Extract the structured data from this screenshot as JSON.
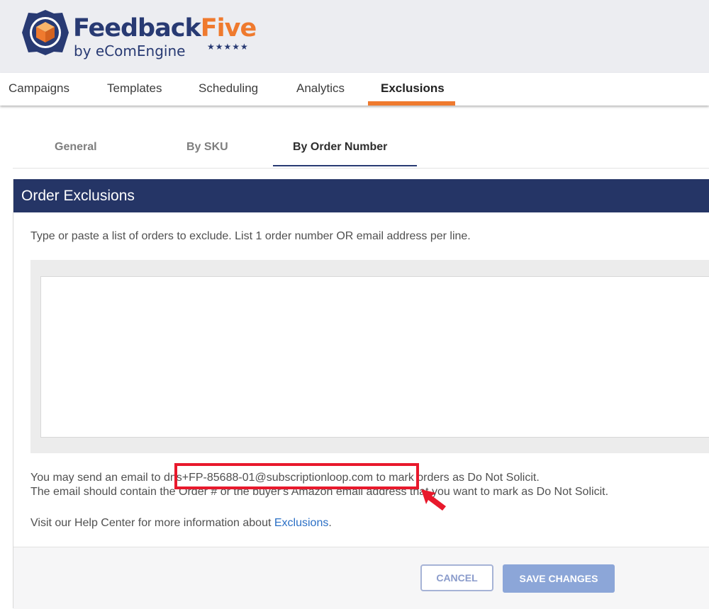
{
  "brand": {
    "name_part1": "Feedback",
    "name_part2": "Five",
    "byline": "by eComEngine",
    "stars": "★★★★★",
    "logo_icon": "box-gear-icon",
    "navy": "#283a73",
    "orange": "#ef7a2e"
  },
  "nav": {
    "items": [
      {
        "label": "Campaigns"
      },
      {
        "label": "Templates"
      },
      {
        "label": "Scheduling"
      },
      {
        "label": "Analytics"
      },
      {
        "label": "Exclusions",
        "active": true
      }
    ]
  },
  "subtabs": [
    {
      "label": "General"
    },
    {
      "label": "By SKU"
    },
    {
      "label": "By Order Number",
      "active": true
    }
  ],
  "panel": {
    "title": "Order Exclusions",
    "instructions": "Type or paste a list of orders to exclude. List 1 order number OR email address per line.",
    "textarea_value": "",
    "note_line1_prefix": "You may send an email to ",
    "email": "dns+FP-85688-01@subscriptionloop.com",
    "note_line1_suffix": " to mark orders as Do Not Solicit.",
    "note_line2": "The email should contain the Order # or the buyer's Amazon email address that you want to mark as Do Not Solicit.",
    "help_prefix": "Visit our Help Center for more information about ",
    "help_link": "Exclusions",
    "help_suffix": "."
  },
  "footer": {
    "cancel_label": "CANCEL",
    "save_label": "SAVE CHANGES"
  },
  "annotation": {
    "color": "#e8192c",
    "arrow_icon": "red-arrow-icon"
  }
}
